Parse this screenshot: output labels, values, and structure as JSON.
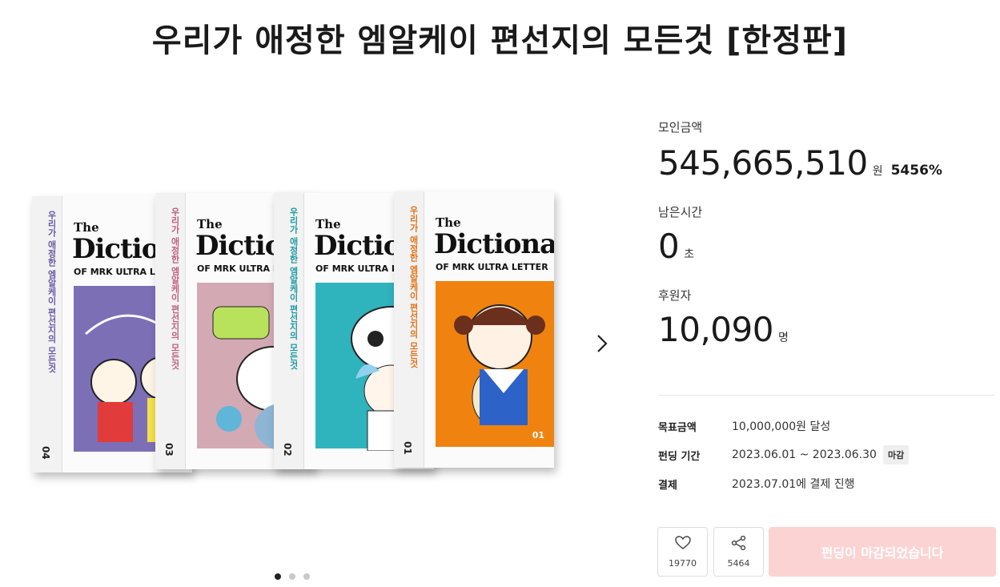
{
  "page": {
    "title": "우리가 애정한 엠알케이 편선지의 모든것 [한정판]"
  },
  "books": [
    {
      "spine_title": "우리가 애정한 엠알케이 편선지의 모든것",
      "number": "04",
      "the": "The",
      "dictionary": "Dictionary",
      "subtitle": "OF MRK ULTRA LETTER",
      "cover_color": "#7d6fb6",
      "spine_color": "#6a5aa8"
    },
    {
      "spine_title": "우리가 애정한 엠알케이 편선지의 모든것",
      "number": "03",
      "the": "The",
      "dictionary": "Dictionary",
      "subtitle": "OF MRK ULTRA LETTER",
      "cover_color": "#d3a9b4",
      "spine_color": "#c0617e"
    },
    {
      "spine_title": "우리가 애정한 엠알케이 편선지의 모든것",
      "number": "02",
      "the": "The",
      "dictionary": "Dictionary",
      "subtitle": "OF MRK ULTRA LETTER",
      "cover_color": "#2fb3bd",
      "spine_color": "#1f9aa6"
    },
    {
      "spine_title": "우리가 애정한 엠알케이 편선지의 모든것",
      "number": "01",
      "the": "The",
      "dictionary": "Dictionary",
      "subtitle": "OF MRK ULTRA LETTER",
      "cover_color": "#f0830f",
      "spine_color": "#e0741a",
      "badge": "01"
    }
  ],
  "gallery": {
    "next_icon": "chevron-right-icon",
    "total_slides": 3,
    "active_slide": 1
  },
  "funding": {
    "raised_label": "모인금액",
    "raised_amount": "545,665,510",
    "raised_unit": "원",
    "percent": "5456%",
    "time_label": "남은시간",
    "time_value": "0",
    "time_unit": "초",
    "backers_label": "후원자",
    "backers_value": "10,090",
    "backers_unit": "명"
  },
  "details": {
    "goal_label": "목표금액",
    "goal_value": "10,000,000원 달성",
    "period_label": "펀딩 기간",
    "period_value": "2023.06.01 ~ 2023.06.30",
    "period_badge": "마감",
    "payment_label": "결제",
    "payment_value": "2023.07.01에 결제 진행"
  },
  "actions": {
    "like_icon": "heart-icon",
    "like_count": "19770",
    "share_icon": "share-icon",
    "share_count": "5464",
    "main_button": "펀딩이 마감되었습니다",
    "main_button_color": "#fcd3d3"
  }
}
